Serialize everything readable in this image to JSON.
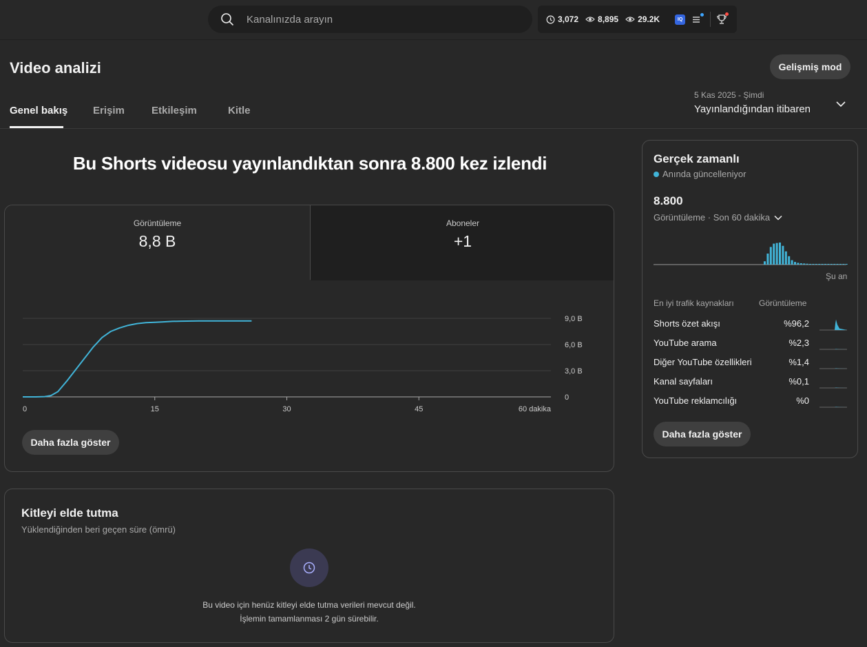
{
  "search": {
    "placeholder": "Kanalınızda arayın"
  },
  "top_stats": {
    "watch": "3,072",
    "views": "8,895",
    "views2": "29.2K",
    "iq_badge": "IQ"
  },
  "header": {
    "title": "Video analizi",
    "advanced_mode": "Gelişmiş mod"
  },
  "tabs": [
    {
      "label": "Genel bakış",
      "active": true
    },
    {
      "label": "Erişim",
      "active": false
    },
    {
      "label": "Etkileşim",
      "active": false
    },
    {
      "label": "Kitle",
      "active": false
    }
  ],
  "date_range": {
    "line1": "5 Kas 2025 - Şimdi",
    "line2": "Yayınlandığından itibaren"
  },
  "headline": "Bu Shorts videosu yayınlandıktan sonra 8.800 kez izlendi",
  "metrics": [
    {
      "label": "Görüntüleme",
      "value": "8,8 B"
    },
    {
      "label": "Aboneler",
      "value": "+1"
    }
  ],
  "chart_data": {
    "type": "line",
    "x_tick_labels": [
      "0",
      "15",
      "30",
      "45",
      "60 dakika"
    ],
    "x_ticks": [
      0,
      15,
      30,
      45,
      60
    ],
    "y_tick_labels": [
      "0",
      "3,0 B",
      "6,0 B",
      "9,0 B"
    ],
    "y_ticks": [
      0,
      3000,
      6000,
      9000
    ],
    "xlim": [
      0,
      60
    ],
    "ylim": [
      0,
      9000
    ],
    "series": [
      {
        "color": "#41b4d8",
        "x": [
          0,
          1.5,
          2.5,
          3.2,
          4,
          5,
          6,
          7,
          8,
          9,
          10,
          11,
          12,
          13,
          14,
          15,
          16,
          17,
          18,
          20,
          22,
          24,
          26
        ],
        "y": [
          0,
          0,
          30,
          150,
          600,
          1800,
          3100,
          4400,
          5700,
          6800,
          7500,
          7900,
          8200,
          8400,
          8500,
          8550,
          8600,
          8650,
          8680,
          8700,
          8700,
          8700,
          8700
        ]
      }
    ],
    "grid": true
  },
  "main_more_button": "Daha fazla göster",
  "retention": {
    "title": "Kitleyi elde tutma",
    "subtitle": "Yüklendiğinden beri geçen süre (ömrü)",
    "message_line1": "Bu video için henüz kitleyi elde tutma verileri mevcut değil.",
    "message_line2": "İşlemin tamamlanması 2 gün sürebilir."
  },
  "realtime": {
    "title": "Gerçek zamanlı",
    "live_label": "Anında güncelleniyor",
    "count": "8.800",
    "period": "Görüntüleme · Son 60 dakika",
    "now_label": "Şu an",
    "spark_bars": [
      0.15,
      0.5,
      0.8,
      0.95,
      0.98,
      1.0,
      0.85,
      0.6,
      0.38,
      0.2,
      0.12,
      0.08,
      0.06,
      0.05,
      0.04,
      0.03,
      0.03,
      0.03,
      0.02,
      0.02,
      0.02,
      0.02,
      0.02,
      0.02,
      0.02,
      0.02,
      0.02,
      0.02,
      0.02
    ],
    "traffic_header_source": "En iyi trafik kaynakları",
    "traffic_header_views": "Görüntüleme",
    "traffic": [
      {
        "name": "Shorts özet akışı",
        "pct": "%96,2",
        "share": 0.962
      },
      {
        "name": "YouTube arama",
        "pct": "%2,3",
        "share": 0.023
      },
      {
        "name": "Diğer YouTube özellikleri",
        "pct": "%1,4",
        "share": 0.014
      },
      {
        "name": "Kanal sayfaları",
        "pct": "%0,1",
        "share": 0.001
      },
      {
        "name": "YouTube reklamcılığı",
        "pct": "%0",
        "share": 0
      }
    ],
    "more_button": "Daha fazla göster"
  },
  "colors": {
    "accent": "#41b4d8",
    "background": "#282828",
    "card_dark": "#1f1f1f"
  }
}
